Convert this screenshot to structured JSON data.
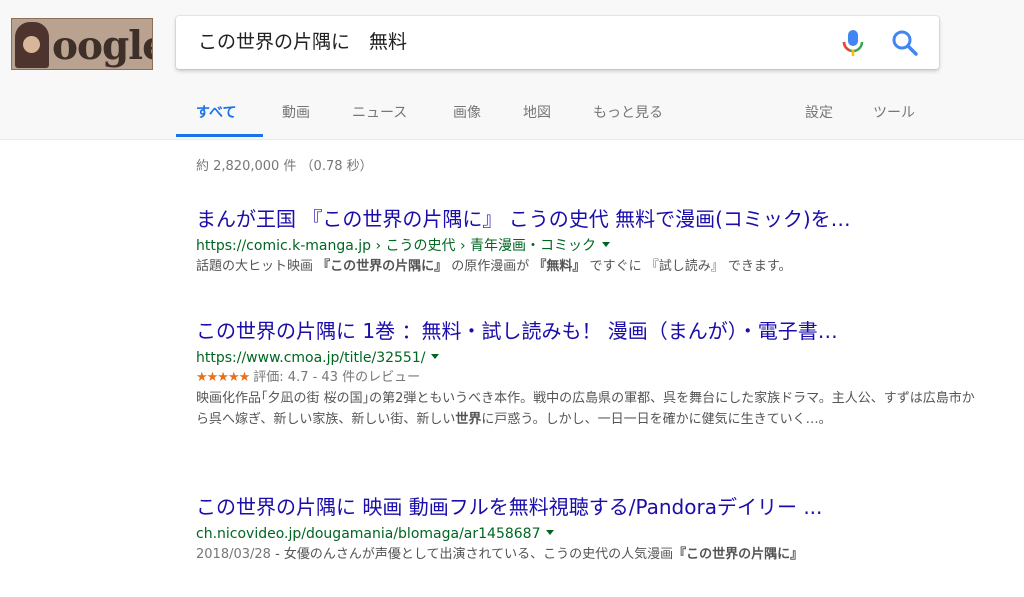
{
  "search": {
    "query": "この世界の片隅に　無料"
  },
  "tabs": [
    {
      "label": "すべて",
      "active": true
    },
    {
      "label": "動画"
    },
    {
      "label": "ニュース"
    },
    {
      "label": "画像"
    },
    {
      "label": "地図"
    },
    {
      "label": "もっと見る"
    },
    {
      "label": "設定"
    },
    {
      "label": "ツール"
    }
  ],
  "stats": "約 2,820,000 件 （0.78 秒）",
  "results": [
    {
      "title": "まんが王国 『この世界の片隅に』 こうの史代 無料で漫画(コミック)を…",
      "url": "https://comic.k-manga.jp › こうの史代 › 青年漫画・コミック",
      "snippet": {
        "t1": "話題の大ヒット映画 ",
        "b1": "『この世界の片隅に』",
        "t2": " の原作漫画が ",
        "b2": "『無料』",
        "t3": " ですぐに 『試し読み』 できます。"
      }
    },
    {
      "title": "この世界の片隅に 1巻 ：無料・試し読みも！ 漫画（まんが）・電子書…",
      "url": "https://www.cmoa.jp/title/32551/",
      "rating": {
        "stars": "★★★★★",
        "value": 4.7,
        "text": "評価: 4.7 - 43 件のレビュー"
      },
      "snippet": {
        "t1": "映画化作品｢夕凪の街 桜の国｣の第2弾ともいうべき本作。戦中の広島県の軍都、呉を舞台にした家族ドラマ。主人公、すずは広島市から呉へ嫁ぎ、新しい家族、新しい街、新しい",
        "b1": "世界",
        "t2": "に戸惑う。しかし、一日一日を確かに健気に生きていく…。"
      }
    },
    {
      "title": "この世界の片隅に 映画 動画フルを無料視聴する/Pandoraデイリー ...",
      "url": "ch.nicovideo.jp/dougamania/blomaga/ar1458687",
      "snippet": {
        "date": "2018/03/28",
        "t1": " - 女優のんさんが声優として出演されている、こうの史代の人気漫画",
        "b1": "『この世界の片隅に』"
      }
    }
  ],
  "colors": {
    "link": "#1a0dab",
    "url": "#006621",
    "tab_active": "#1a73e8",
    "stars": "#e7711b"
  }
}
